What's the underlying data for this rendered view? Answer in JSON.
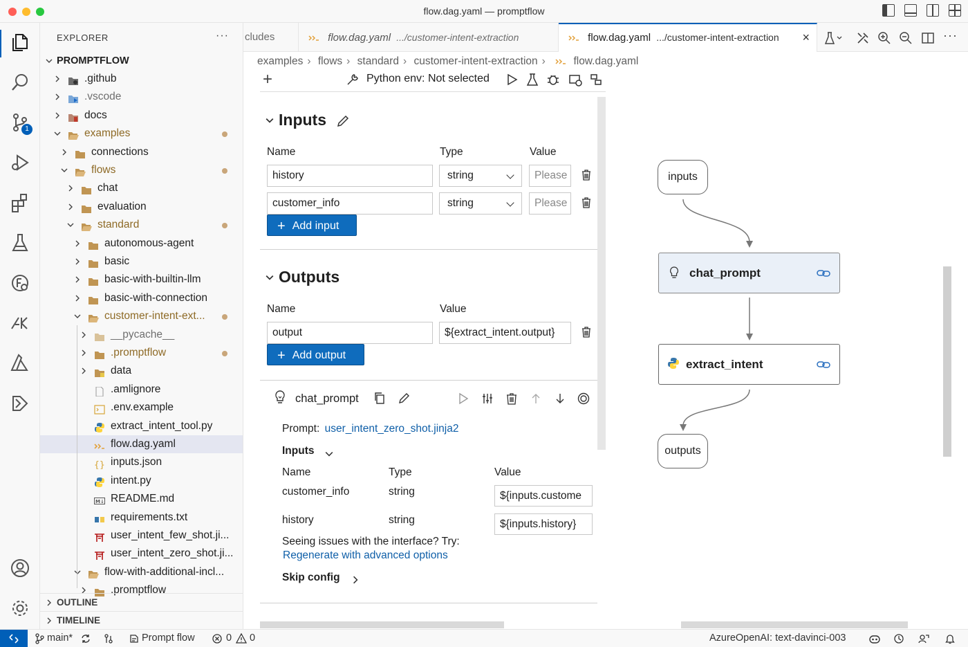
{
  "window": {
    "title": "flow.dag.yaml — promptflow"
  },
  "activity": {
    "scm_badge": "1"
  },
  "explorer": {
    "header": "EXPLORER",
    "more": "···",
    "root": "PROMPTFLOW",
    "items": [
      {
        "label": ".github"
      },
      {
        "label": ".vscode"
      },
      {
        "label": "docs"
      },
      {
        "label": "examples"
      },
      {
        "label": "connections"
      },
      {
        "label": "flows"
      },
      {
        "label": "chat"
      },
      {
        "label": "evaluation"
      },
      {
        "label": "standard"
      },
      {
        "label": "autonomous-agent"
      },
      {
        "label": "basic"
      },
      {
        "label": "basic-with-builtin-llm"
      },
      {
        "label": "basic-with-connection"
      },
      {
        "label": "customer-intent-ext..."
      },
      {
        "label": "__pycache__"
      },
      {
        "label": ".promptflow"
      },
      {
        "label": "data"
      },
      {
        "label": ".amlignore"
      },
      {
        "label": ".env.example"
      },
      {
        "label": "extract_intent_tool.py"
      },
      {
        "label": "flow.dag.yaml"
      },
      {
        "label": "inputs.json"
      },
      {
        "label": "intent.py"
      },
      {
        "label": "README.md"
      },
      {
        "label": "requirements.txt"
      },
      {
        "label": "user_intent_few_shot.ji..."
      },
      {
        "label": "user_intent_zero_shot.ji..."
      },
      {
        "label": "flow-with-additional-incl..."
      },
      {
        "label": ".promptflow"
      }
    ],
    "outline": "OUTLINE",
    "timeline": "TIMELINE"
  },
  "tabs": [
    {
      "name": "cludes",
      "path": ""
    },
    {
      "name": "flow.dag.yaml",
      "path": ".../customer-intent-extraction"
    },
    {
      "name": "flow.dag.yaml",
      "path": ".../customer-intent-extraction"
    }
  ],
  "breadcrumb": [
    "examples",
    "flows",
    "standard",
    "customer-intent-extraction",
    "flow.dag.yaml"
  ],
  "toolbar": {
    "python_env": "Python env: Not selected"
  },
  "inputs": {
    "title": "Inputs",
    "col_name": "Name",
    "col_type": "Type",
    "col_value": "Value",
    "rows": [
      {
        "name": "history",
        "type": "string",
        "placeholder": "Please"
      },
      {
        "name": "customer_info",
        "type": "string",
        "placeholder": "Please"
      }
    ],
    "add_label": "Add input"
  },
  "outputs": {
    "title": "Outputs",
    "col_name": "Name",
    "col_value": "Value",
    "rows": [
      {
        "name": "output",
        "value": "${extract_intent.output}"
      }
    ],
    "add_label": "Add output"
  },
  "node": {
    "name": "chat_prompt",
    "prompt_label": "Prompt:",
    "prompt_file": "user_intent_zero_shot.jinja2",
    "inputs_label": "Inputs",
    "col_name": "Name",
    "col_type": "Type",
    "col_value": "Value",
    "rows": [
      {
        "name": "customer_info",
        "type": "string",
        "value": "${inputs.custome"
      },
      {
        "name": "history",
        "type": "string",
        "value": "${inputs.history}"
      }
    ],
    "issues_text": "Seeing issues with the interface? Try:",
    "regenerate": "Regenerate with advanced options",
    "skip_config": "Skip config"
  },
  "graph": {
    "nodes": [
      "inputs",
      "chat_prompt",
      "extract_intent",
      "outputs"
    ]
  },
  "status": {
    "branch": "main*",
    "prompt_flow": "Prompt flow",
    "errors": "0",
    "warnings": "0",
    "model": "AzureOpenAI: text-davinci-003"
  }
}
